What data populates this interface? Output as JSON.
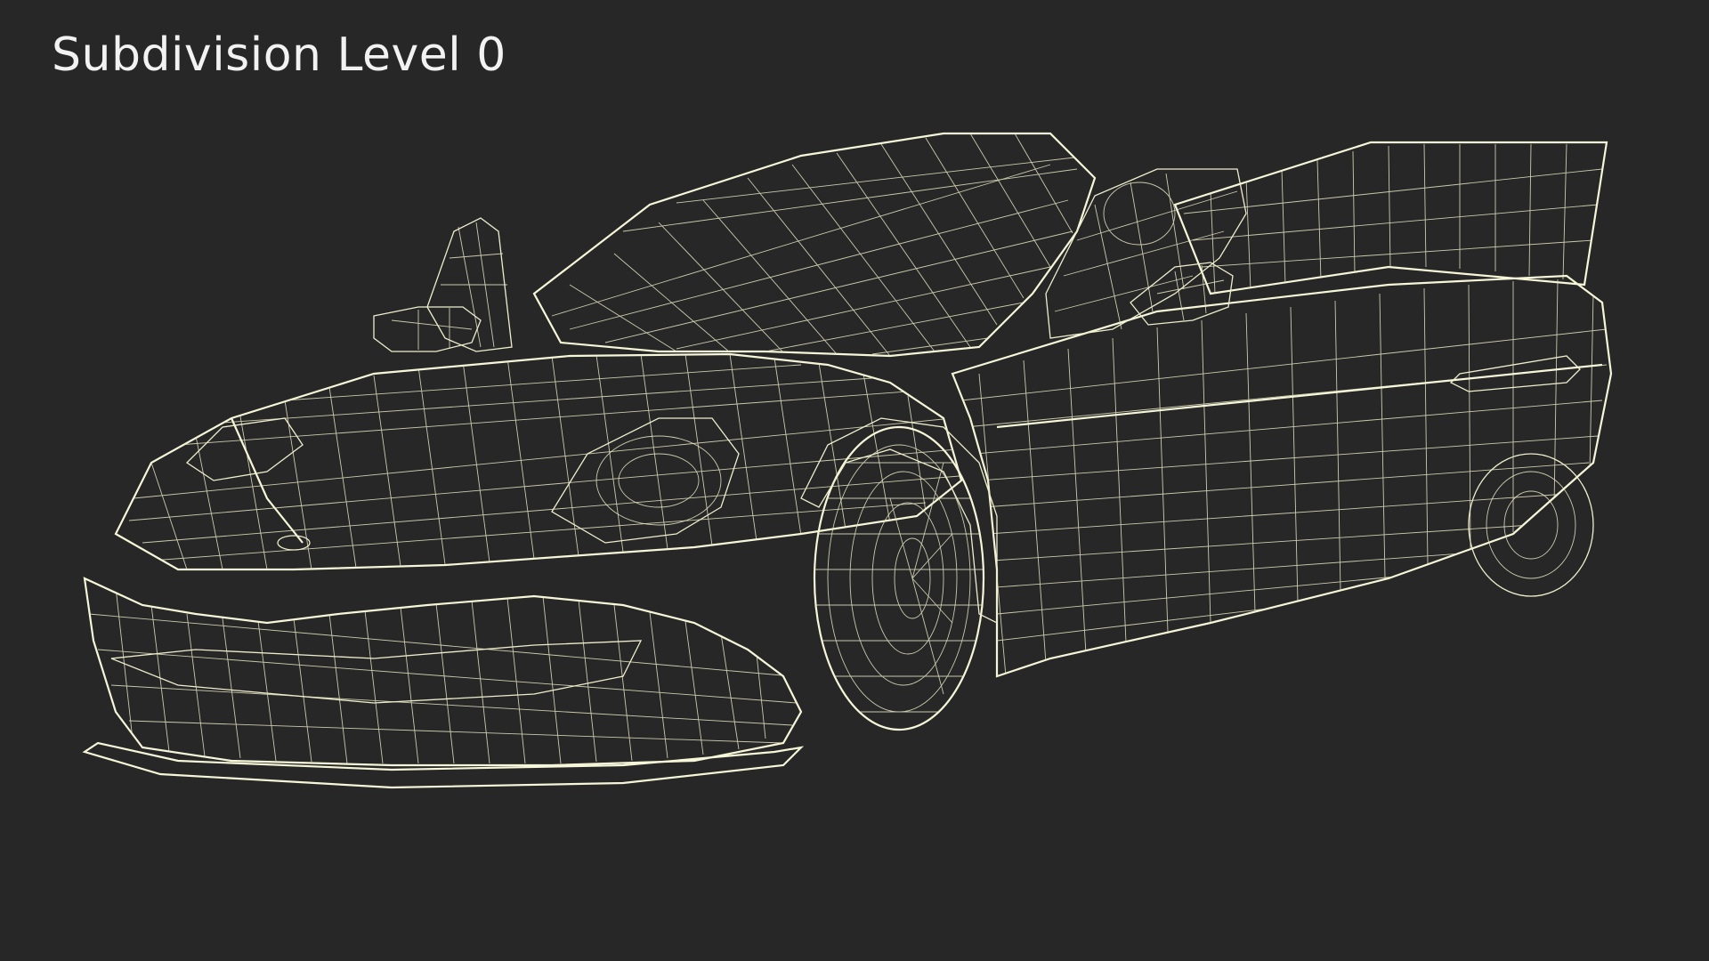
{
  "viewport": {
    "label": "Subdivision Level 0",
    "background_color": "#272727",
    "label_color": "#f2f2f2"
  },
  "model": {
    "mesh_color": "#6b6b5c",
    "wire_color": "#eeeecd",
    "icon": "wireframe-car-render"
  }
}
